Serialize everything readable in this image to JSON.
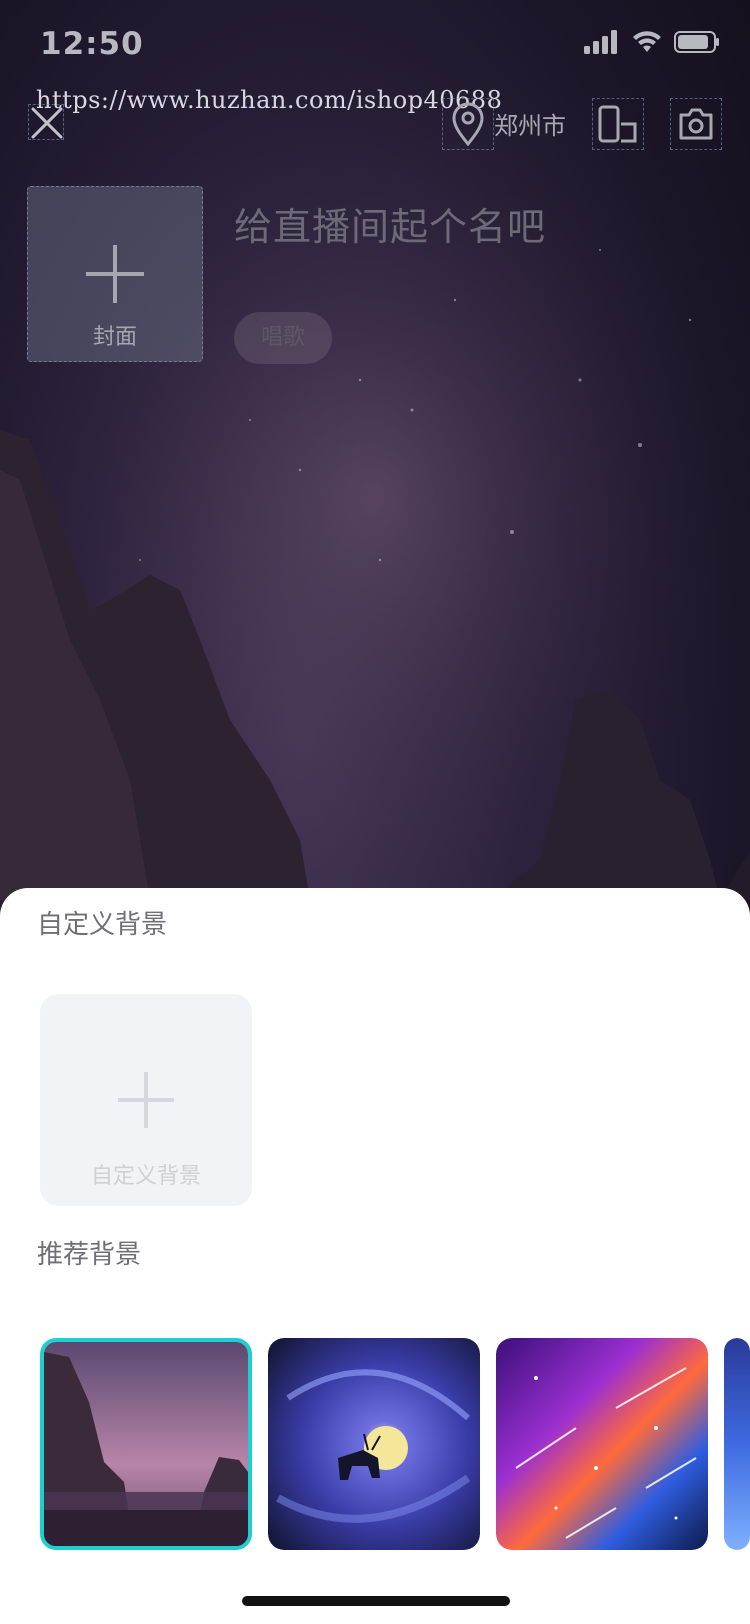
{
  "status_bar": {
    "time": "12:50"
  },
  "watermark": "https://www.huzhan.com/ishop40688",
  "top_bar": {
    "close_icon": "close-icon",
    "location_icon": "location-pin-icon",
    "location_label": "郑州市",
    "flip_icon": "screen-orientation-icon",
    "camera_icon": "camera-switch-icon"
  },
  "room": {
    "cover_label": "封面",
    "title_placeholder": "给直播间起个名吧",
    "tag_label": "唱歌"
  },
  "sheet": {
    "custom_section_title": "自定义背景",
    "custom_tile_label": "自定义背景",
    "recommended_section_title": "推荐背景",
    "recommended": [
      {
        "name": "rocky-canyon-night",
        "selected": true
      },
      {
        "name": "deer-moon-swirl",
        "selected": false
      },
      {
        "name": "colorful-galaxy-meteors",
        "selected": false
      },
      {
        "name": "partial-thumbnail",
        "selected": false
      }
    ]
  },
  "colors": {
    "selection_border": "#1fcfd0",
    "sheet_bg": "#ffffff",
    "placeholder_text": "#6c6a76"
  }
}
